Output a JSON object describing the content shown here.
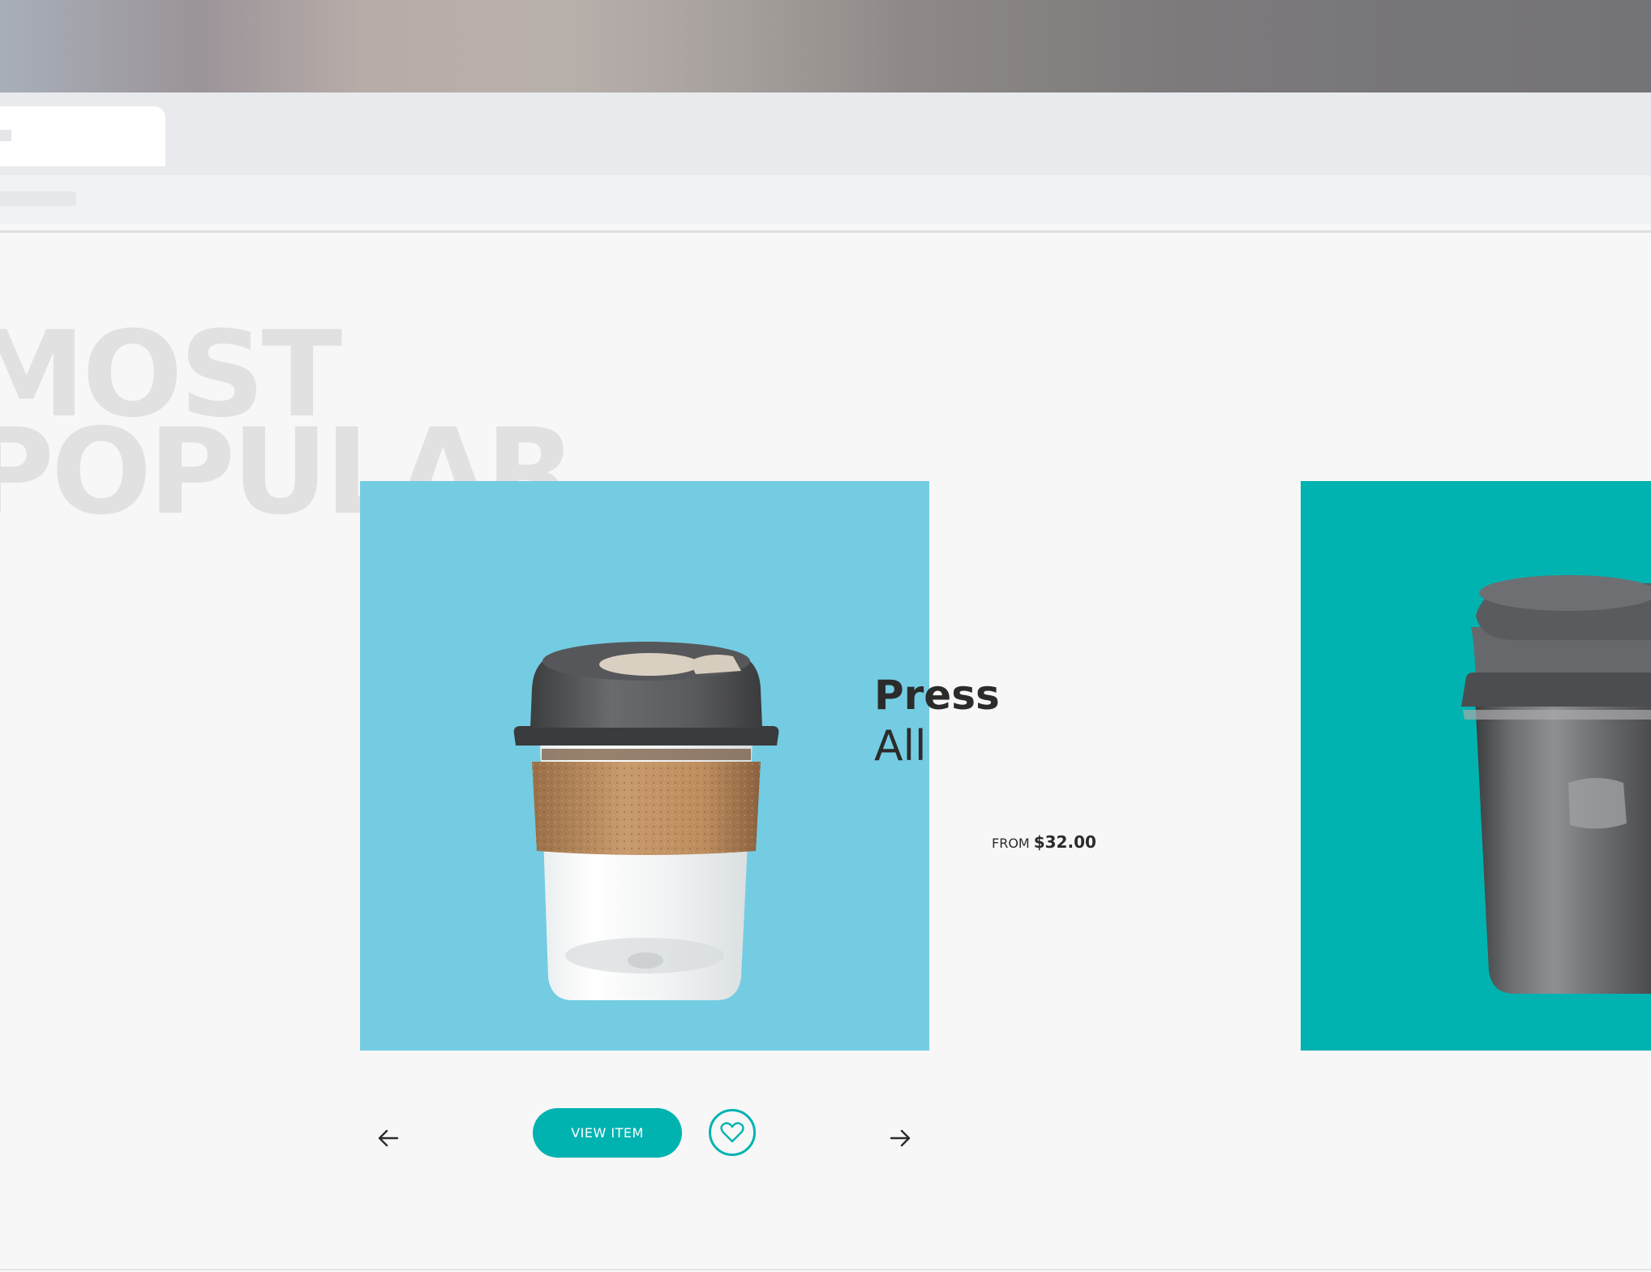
{
  "section": {
    "heading_line1": "MOST",
    "heading_line2": "POPULAR"
  },
  "carousel": {
    "active_product": {
      "name": "Press",
      "subtitle": "All",
      "price_prefix": "FROM",
      "price": "$32.00",
      "card_color": "#74cce2",
      "image": "glass-cup-cork-band"
    },
    "next_product": {
      "card_color": "#00b3b0",
      "image": "steel-thermal-cup"
    },
    "buttons": {
      "view_item": "VIEW ITEM",
      "favorite_icon": "heart-icon",
      "prev_icon": "arrow-left-icon",
      "next_icon": "arrow-right-icon"
    }
  },
  "colors": {
    "accent": "#00b3b0",
    "text": "#2b2b2b",
    "background": "#f7f7f7",
    "heading_ghost": "#e1e1e1"
  }
}
